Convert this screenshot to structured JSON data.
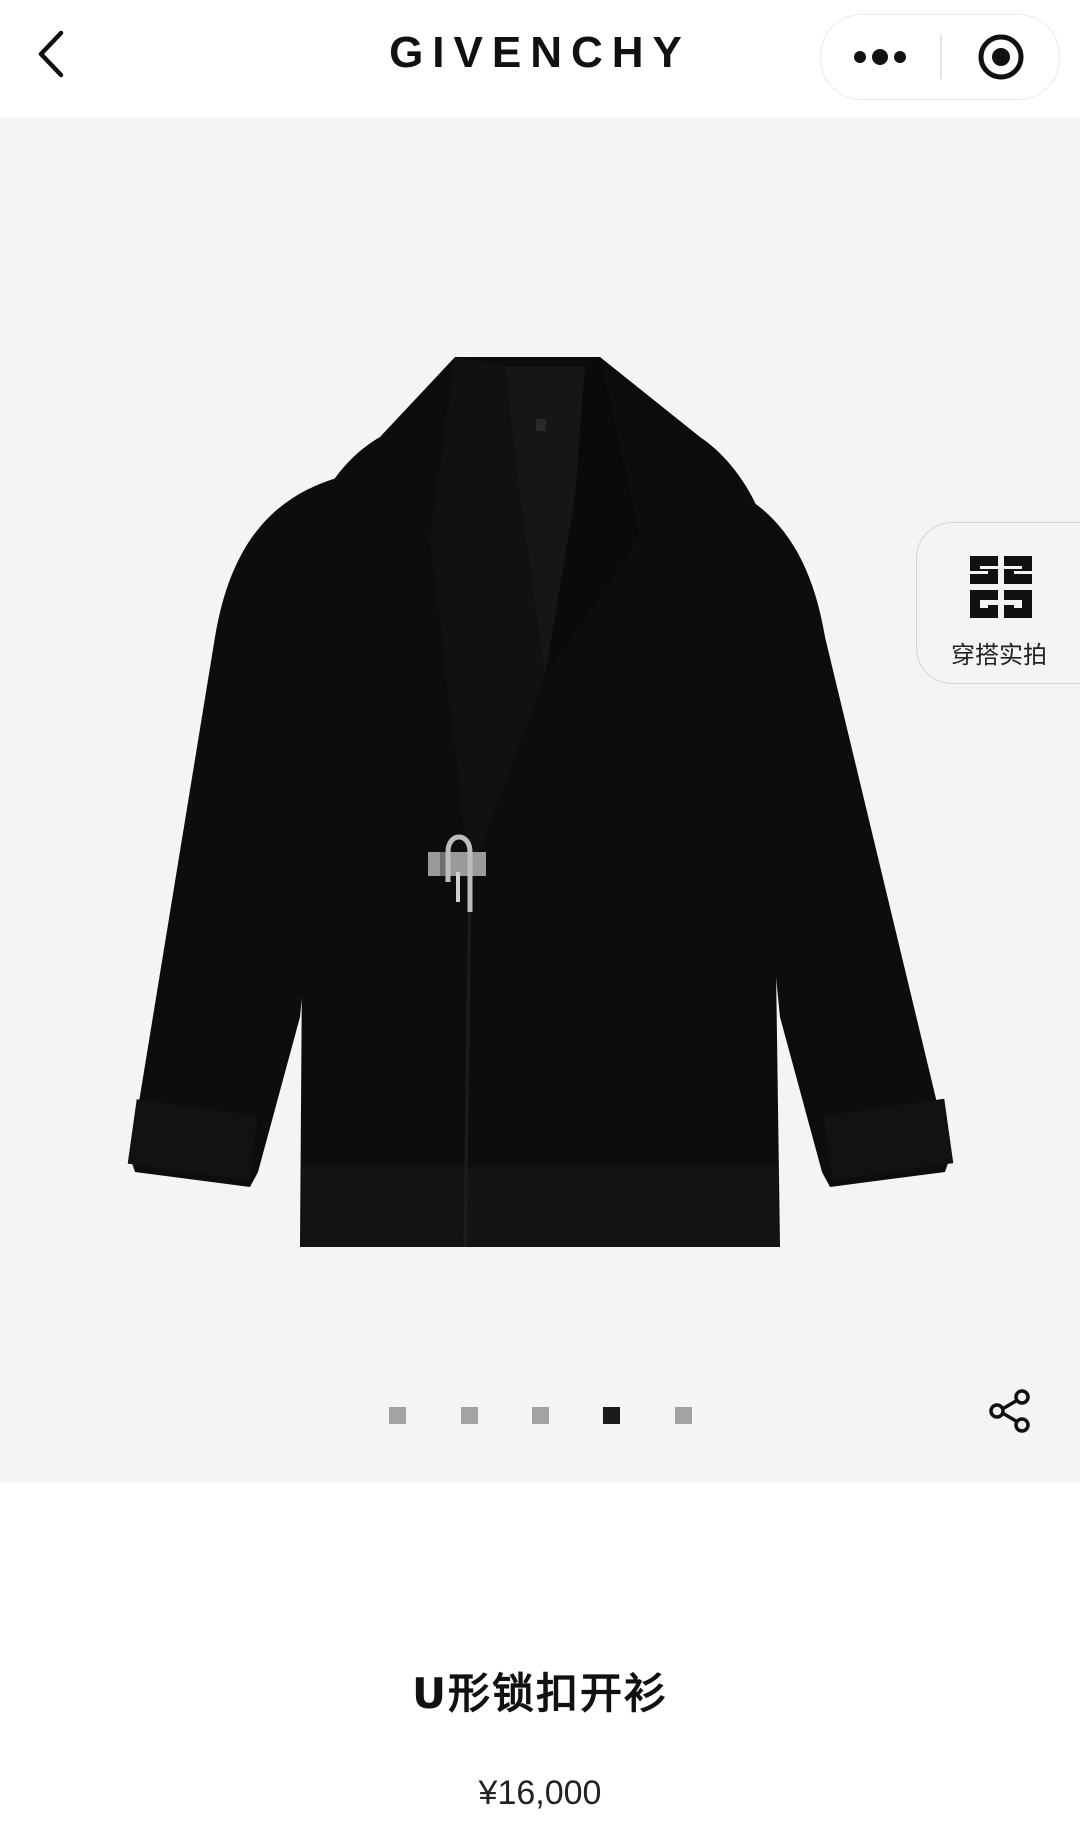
{
  "header": {
    "brand": "GIVENCHY",
    "back_icon": "chevron-left-icon",
    "more_icon": "more-dots-icon",
    "close_icon": "target-circle-icon"
  },
  "gallery": {
    "image_alt": "black knit cardigan with padlock closure",
    "total_images": 5,
    "active_index": 3,
    "share_icon": "share-icon"
  },
  "lookbook": {
    "logo_icon": "4g-monogram-icon",
    "label": "穿搭实拍"
  },
  "product": {
    "title": "U形锁扣开衫",
    "price": "¥16,000"
  },
  "colors": {
    "image_bg": "#f4f4f4",
    "dot_inactive": "#a3a3a3",
    "dot_active": "#1a1a1a",
    "garment": "#0d0d0d"
  }
}
